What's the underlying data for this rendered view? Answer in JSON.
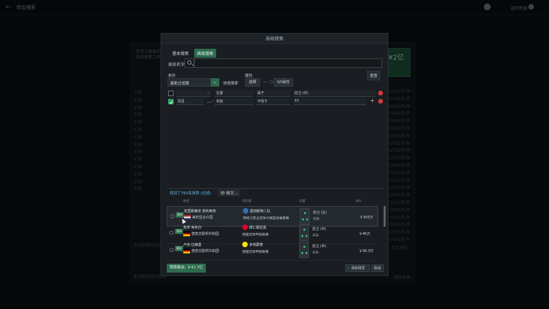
{
  "app": {
    "page_title": "转会搜索",
    "back_label": "返回资源"
  },
  "background": {
    "intro_text": "你可以根据你需要设置\n转会搜索工具",
    "funds_label": "¥2亿",
    "right_column": [
      "￥2457万/年",
      "￥2406万/年",
      "￥2400万/年",
      "￥2400万/年",
      "￥2400万/年",
      "￥2400万/年",
      "￥2400万/年",
      "￥2352万/年",
      "￥2352万/年",
      "￥2500万/年",
      "￥2500万/年",
      "￥2500万/年",
      "￥2500万/年",
      "￥2500万/年",
      "￥2500万/年",
      "￥2500万/年",
      "￥2500万/年",
      "￥2500万/年",
      "￥2500万/年",
      "￥2500万/年",
      "￥2500万/年"
    ],
    "left_column": [
      "位置",
      "前锋",
      "前锋",
      "前锋",
      "前锋",
      "前锋",
      "前锋",
      "前锋",
      "前锋",
      "前锋",
      "前锋",
      "前锋",
      "前锋",
      "前锋"
    ],
    "bottom_text": "自动组建转会预算",
    "bottom_text2": "建议新的替代球员",
    "bottom_right": "显示退役",
    "bottom_right2": "高级搜索"
  },
  "modal": {
    "title": "高级搜索",
    "tabs": [
      {
        "label": "基本搜索",
        "active": false
      },
      {
        "label": "高级搜索",
        "active": true
      }
    ],
    "player_name_label": "球员名字",
    "player_name_placeholder": "",
    "conditions_label": "条件",
    "attributes_label": "属性",
    "reset_label": "重置",
    "filter_select_value": "最新过滤器",
    "quick_search_label": "快速搜索",
    "attr_select_label": "选择",
    "attr_range_label": "0/0属性",
    "conditions": [
      {
        "checked": false,
        "field1": "",
        "field2": "位置",
        "operator": "属于",
        "value": "前卫 (中)"
      },
      {
        "checked": true,
        "connector": "而且",
        "field2": "年龄",
        "operator": "不低于",
        "value": "10"
      }
    ],
    "results_label": "找到了783名球员 (过滤)",
    "view_label": "概况",
    "columns": [
      "姓名",
      "俱乐部",
      "位置",
      "身价"
    ],
    "players": [
      {
        "position_badge": "替补",
        "name": "克里斯蒂安·普利西奇",
        "nation": "美利坚合众国",
        "club": "曼彻斯特二队",
        "league": "英格兰职业足球大联盟发展联赛",
        "position": "前卫 (左)",
        "known": "未知",
        "value": "￥305万",
        "flag_colors": [
          "#b22234",
          "#ffffff",
          "#3c3b6e"
        ],
        "club_color": "#2f6fb5",
        "selected": true
      },
      {
        "position_badge": "替补",
        "name": "朱罗·希利尔",
        "nation": "德意志联邦共和国",
        "club": "拜仁慕尼黑",
        "league": "德国足球甲级联赛",
        "position": "前卫 (中)",
        "known": "未知",
        "value": "￥46万",
        "flag_colors": [
          "#000000",
          "#dd0000",
          "#ffce00"
        ],
        "club_color": "#dc052d",
        "selected": false
      },
      {
        "position_badge": "替补",
        "name": "卢克·拉赫曼",
        "nation": "德意志联邦共和国",
        "club": "多特蒙德",
        "league": "德国足球甲级联赛",
        "position": "前卫 (中)",
        "known": "未知",
        "value": "￥38.3万",
        "flag_colors": [
          "#000000",
          "#dd0000",
          "#ffce00"
        ],
        "club_color": "#fde100",
        "selected": false
      }
    ],
    "balance_label": "预算剩余: ￥47.7亿",
    "confirm_label": "添加球员",
    "cancel_label": "取消"
  },
  "colors": {
    "accent": "#2e6b4e",
    "link": "#6db8e8",
    "danger": "#d23a3a",
    "check": "#2ea05e"
  }
}
